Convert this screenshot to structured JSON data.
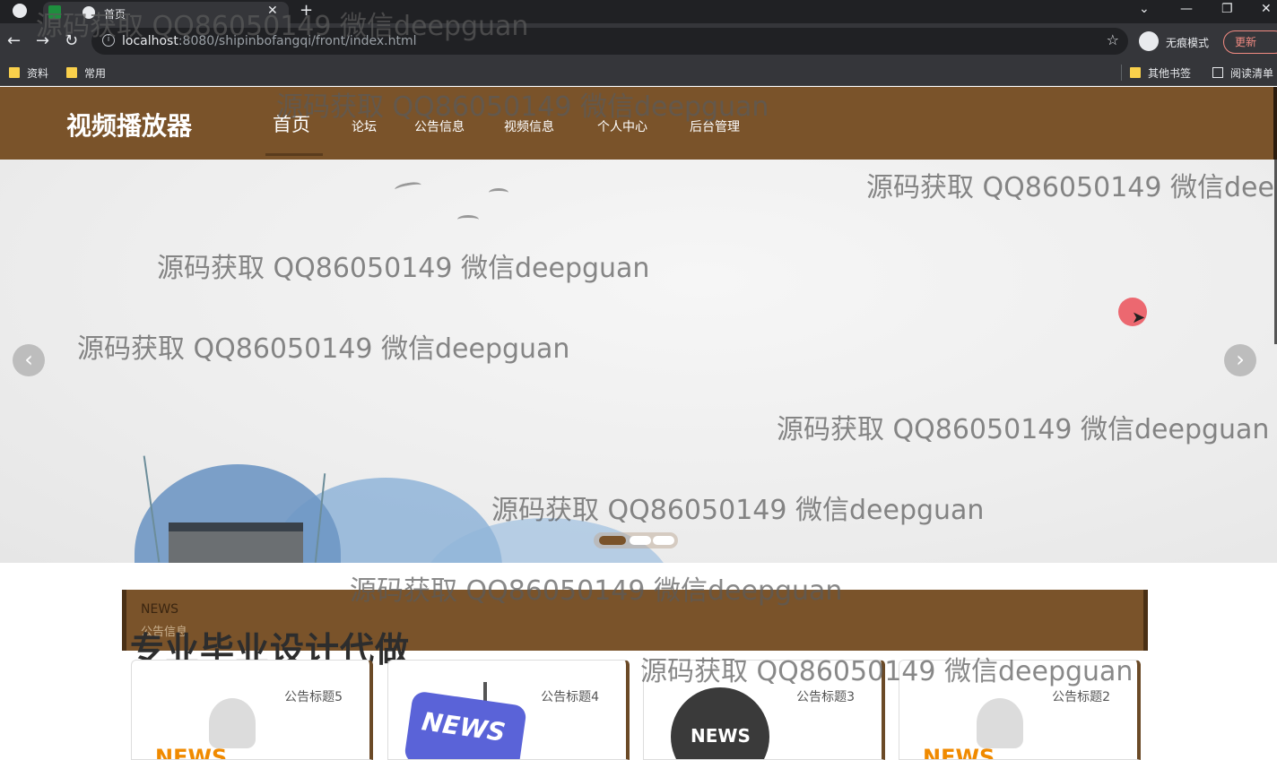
{
  "browser": {
    "tab_title": "首页",
    "url_host": "localhost",
    "url_rest": ":8080/shipinbofangqi/front/index.html",
    "incognito_label": "无痕模式",
    "update_label": "更新",
    "bookmarks": [
      "资料",
      "常用"
    ],
    "other_bookmarks": "其他书签",
    "reading_list": "阅读清单"
  },
  "site": {
    "brand": "视频播放器",
    "nav": [
      "首页",
      "论坛",
      "公告信息",
      "视频信息",
      "个人中心",
      "后台管理"
    ],
    "active_nav": "首页"
  },
  "banner": {
    "slide_count": 3,
    "active_slide": 1,
    "prev_icon": "chevron-left-icon",
    "next_icon": "chevron-right-icon"
  },
  "news": {
    "heading_en": "NEWS",
    "heading_cn": "公告信息",
    "promo": "专业毕业设计代做",
    "cards": [
      {
        "title": "公告标题5",
        "image": "news-reader-figure"
      },
      {
        "title": "公告标题4",
        "image": "news-blue-sign"
      },
      {
        "title": "公告标题3",
        "image": "news-globe"
      },
      {
        "title": "公告标题2",
        "image": "news-reader-figure"
      }
    ]
  },
  "watermark": "源码获取 QQ86050149 微信deepguan",
  "colors": {
    "header_brown": "#7a532a",
    "browser_dark": "#202124",
    "toolbar": "#35363a"
  }
}
